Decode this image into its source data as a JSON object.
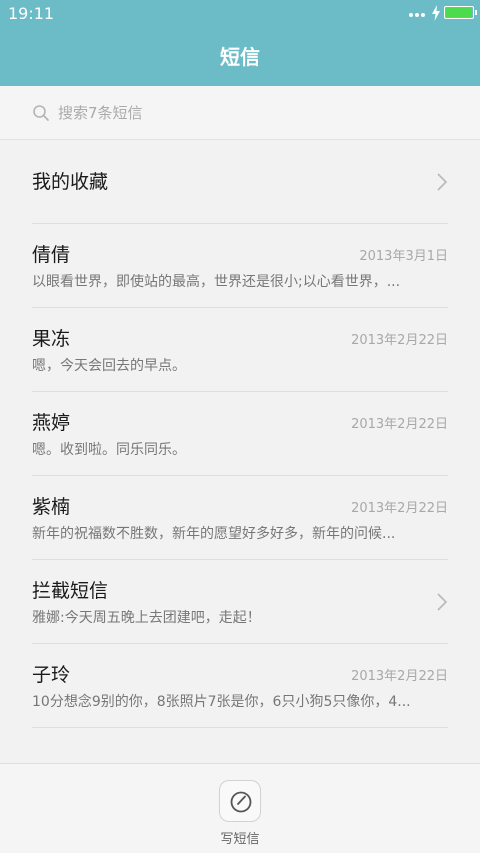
{
  "status_bar": {
    "time": "19:11",
    "battery_level": 1.0,
    "battery_color": "#4cdb4c"
  },
  "header": {
    "title": "短信",
    "background_color": "#6bbcc6"
  },
  "search": {
    "placeholder": "搜索7条短信",
    "icon": "search-icon"
  },
  "favorites": {
    "label": "我的收藏",
    "icon": "chevron-right-icon"
  },
  "conversations": [
    {
      "name": "倩倩",
      "date": "2013年3月1日",
      "preview": "以眼看世界，即使站的最高，世界还是很小;以心看世界，..."
    },
    {
      "name": "果冻",
      "date": "2013年2月22日",
      "preview": "嗯，今天会回去的早点。"
    },
    {
      "name": "燕婷",
      "date": "2013年2月22日",
      "preview": "嗯。收到啦。同乐同乐。"
    },
    {
      "name": "紫楠",
      "date": "2013年2月22日",
      "preview": "新年的祝福数不胜数，新年的愿望好多好多，新年的问候..."
    }
  ],
  "blocked": {
    "name": "拦截短信",
    "preview": "雅娜:今天周五晚上去团建吧，走起！",
    "icon": "chevron-right-icon"
  },
  "conversations_after": [
    {
      "name": "子玲",
      "date": "2013年2月22日",
      "preview": "10分想念9别的你，8张照片7张是你，6只小狗5只像你，4..."
    }
  ],
  "bottom": {
    "compose_label": "写短信",
    "icon": "compose-icon"
  }
}
